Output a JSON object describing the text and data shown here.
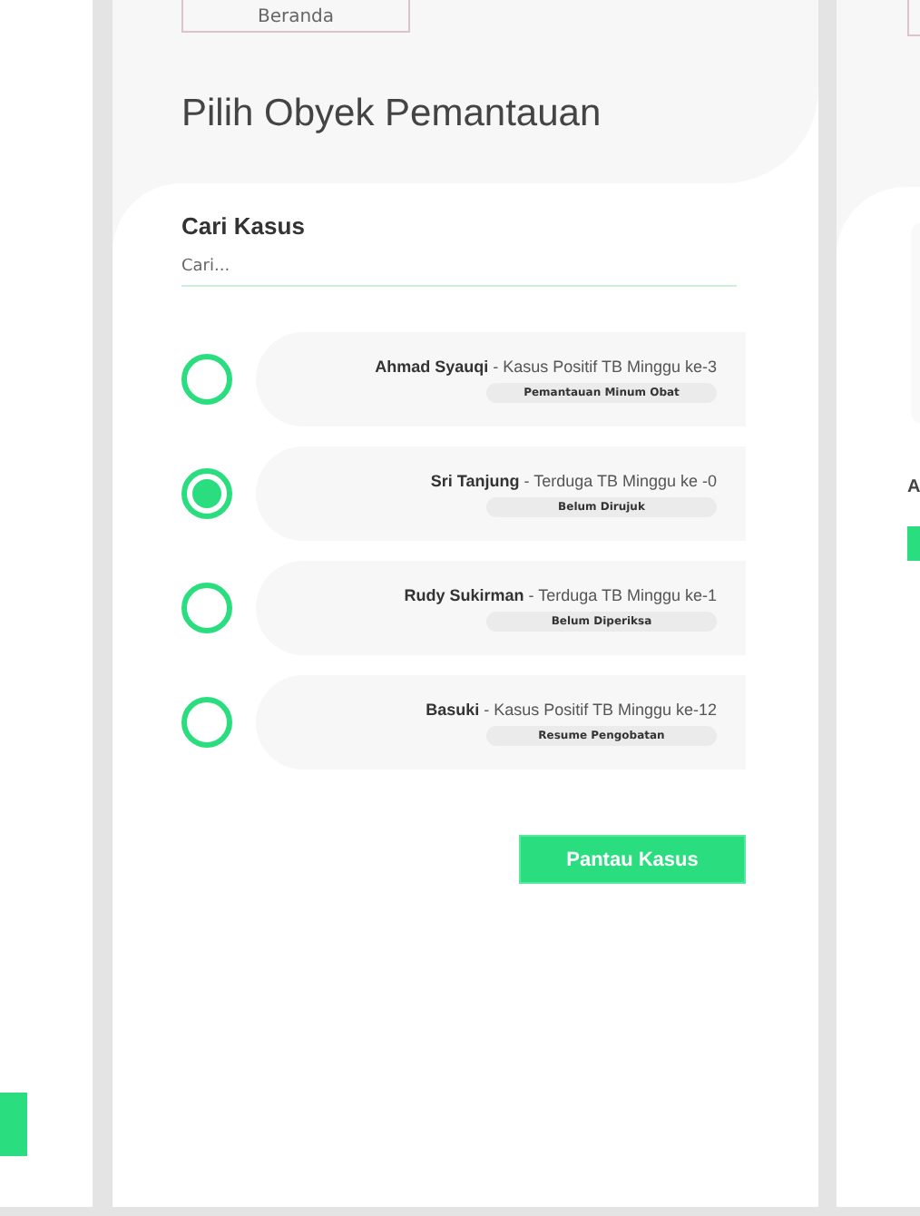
{
  "home_button": {
    "label": "Beranda"
  },
  "title": "Pilih Obyek Pemantauan",
  "search": {
    "label": "Cari Kasus",
    "placeholder": "Cari..."
  },
  "cases": [
    {
      "text": "**Ahmad Syauqi** - Kasus Positif TB Minggu ke-3",
      "status": "Pemantauan Minum Obat",
      "selected": false
    },
    {
      "text": "**Sri Tanjung** - Terduga TB Minggu ke -0",
      "status": "Belum Dirujuk",
      "selected": true
    },
    {
      "text": "**Rudy Sukirman** - Terduga TB Minggu ke-1",
      "status": "Belum Diperiksa",
      "selected": false
    },
    {
      "text": "**Basuki** - Kasus Positif TB Minggu ke-12",
      "status": "Resume Pengobatan",
      "selected": false
    }
  ],
  "submit_button": {
    "label": "Pantau Kasus"
  },
  "next_artboard": {
    "label": "A"
  }
}
